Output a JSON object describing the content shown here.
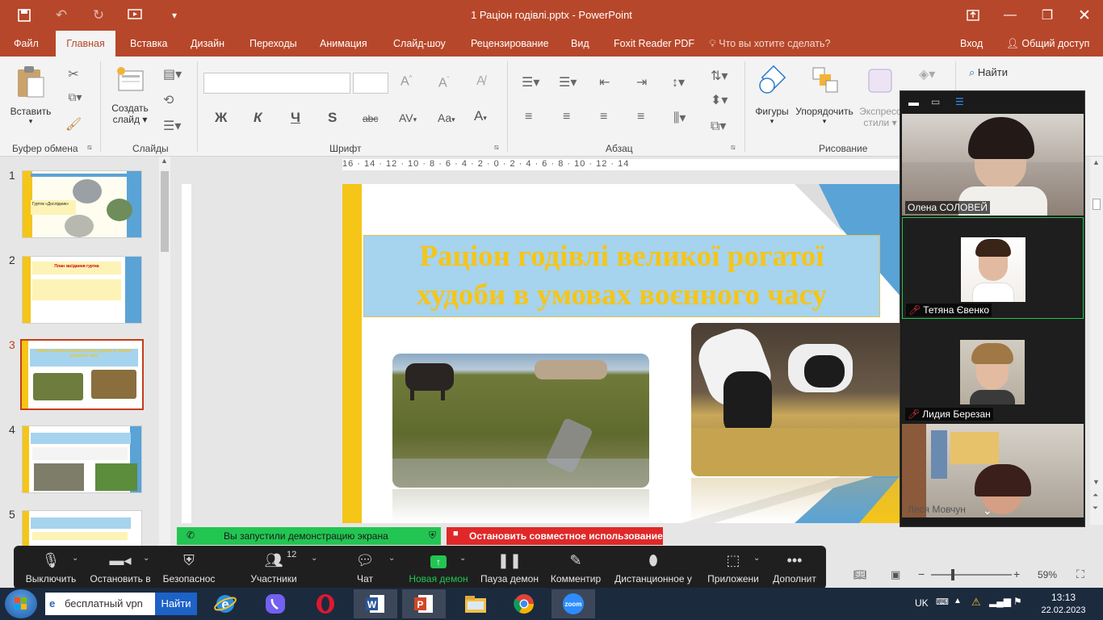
{
  "window": {
    "title": "1 Раціон годівлі.pptx - PowerPoint"
  },
  "tabs": {
    "file": "Файл",
    "home": "Главная",
    "insert": "Вставка",
    "design": "Дизайн",
    "transitions": "Переходы",
    "animation": "Анимация",
    "slideshow": "Слайд-шоу",
    "review": "Рецензирование",
    "view": "Вид",
    "foxit": "Foxit Reader PDF",
    "tellme": "Что вы хотите сделать?",
    "signin": "Вход",
    "share": "Общий доступ"
  },
  "ribbon": {
    "paste": "Вставить",
    "clipboard_group": "Буфер обмена",
    "new_slide_line1": "Создать",
    "new_slide_line2": "слайд",
    "slides_group": "Слайды",
    "font_group": "Шрифт",
    "paragraph_group": "Абзац",
    "shapes": "Фигуры",
    "arrange": "Упорядочить",
    "quick_styles_line1": "Экспресс",
    "quick_styles_line2": "стили",
    "drawing_group": "Рисование",
    "find": "Найти",
    "bold": "Ж",
    "italic": "К",
    "underline": "Ч",
    "strike": "S",
    "strikethrough": "abc",
    "spacing": "AV",
    "case": "Aa",
    "fontcolor": "A"
  },
  "thumbnails": [
    {
      "num": "1",
      "title": "Гурток «Дослідник»"
    },
    {
      "num": "2",
      "title": "План засідання гуртка"
    },
    {
      "num": "3",
      "title": "Раціон годівлі великої рогатої худоби в умовах воєнного часу"
    },
    {
      "num": "4",
      "title": ""
    },
    {
      "num": "5",
      "title": ""
    }
  ],
  "ruler": {
    "h_labels": "16 · 14 · 12 · 10 · 8 · 6 · 4 · 2 · 0 · 2 · 4 · 6 · 8 · 10 · 12 · 14"
  },
  "slide": {
    "title_line1": "Раціон годівлі великої рогатої",
    "title_line2": "худоби в умовах воєнного часу"
  },
  "zoom": {
    "participants": [
      {
        "name": "Олена СОЛОВЕЙ",
        "muted": false
      },
      {
        "name": "Тетяна Євенко",
        "muted": true
      },
      {
        "name": "Лидия Березан",
        "muted": true
      },
      {
        "name": "Леся Мовчун",
        "muted": false
      }
    ],
    "share_notice": "Вы запустили демонстрацию экрана",
    "stop_share": "Остановить совместное использование",
    "participants_count": "12",
    "toolbar": {
      "mute": "Выключить",
      "video": "Остановить в",
      "security": "Безопаснос",
      "participants": "Участники",
      "chat": "Чат",
      "new_share": "Новая демон",
      "pause_share": "Пауза демон",
      "annotate": "Комментир",
      "remote": "Дистанционное у",
      "apps": "Приложени",
      "more": "Дополнит"
    }
  },
  "statusbar": {
    "zoom_level": "59%",
    "zoom_fraction": 0.59
  },
  "taskbar": {
    "search_value": "бесплатный vpn",
    "search_button": "Найти",
    "lang": "UK",
    "time": "13:13",
    "date": "22.02.2023"
  },
  "colors": {
    "accent": "#b7472a",
    "slide_title": "#f5c518",
    "slide_title_bg": "#a6d3ee",
    "share_green": "#23c552",
    "share_red": "#e02828"
  }
}
